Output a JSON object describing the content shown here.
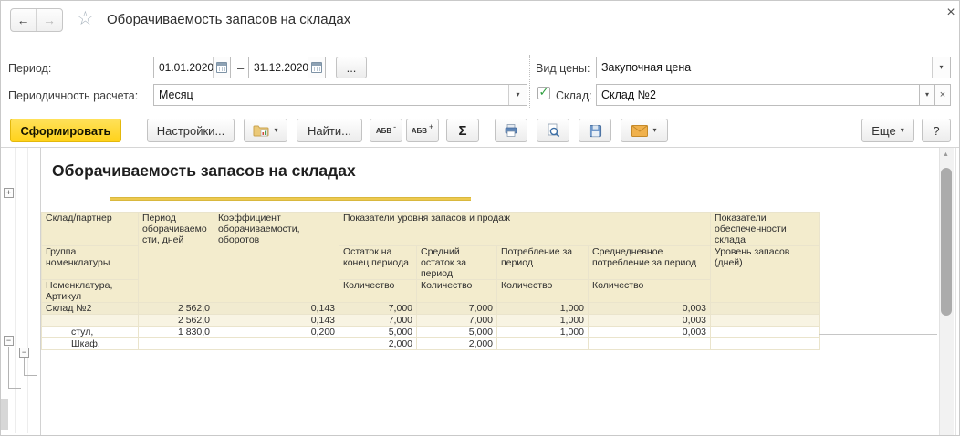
{
  "window": {
    "title": "Оборачиваемость запасов на складах"
  },
  "icons": {
    "back": "←",
    "forward": "→",
    "favorite_star": "☆",
    "close": "×",
    "dropdown": "▾",
    "checkmark": "✓",
    "expand_plus": "+",
    "collapse_minus": "−",
    "scroll_up": "▲"
  },
  "filters": {
    "period_label": "Период:",
    "period_from": "01.01.2020",
    "period_to": "31.12.2020",
    "period_dash": "–",
    "period_more_label": "...",
    "periodicity_label": "Периодичность расчета:",
    "periodicity_value": "Месяц",
    "price_type_label": "Вид цены:",
    "price_type_value": "Закупочная цена",
    "warehouse_label": "Склад:",
    "warehouse_value": "Склад №2"
  },
  "toolbar": {
    "generate_label": "Сформировать",
    "settings_label": "Настройки...",
    "find_label": "Найти...",
    "fontsize_label": "АБВ",
    "font_decrease_sign": "-",
    "font_increase_sign": "+",
    "sum_label": "Σ",
    "more_label": "Еще",
    "help_label": "?"
  },
  "report": {
    "title": "Оборачиваемость запасов на складах"
  },
  "table": {
    "header": {
      "warehouse_partner": "Склад/партнер",
      "nomenclature_group": "Группа номенклатуры",
      "nomenclature_article": "Номенклатура, Артикул",
      "turnover_period_days": "Период оборачиваемости, дней",
      "turnover_ratio": "Коэффициент оборачиваемости, оборотов",
      "stock_sales_group": "Показатели уровня запасов и продаж",
      "end_of_period_balance": "Остаток на конец периода",
      "average_balance": "Средний остаток за период",
      "consumption": "Потребление за период",
      "avg_daily_consumption": "Среднедневное потребление за период",
      "supply_group": "Показатели обеспеченности склада",
      "stock_level_days": "Уровень запасов (дней)",
      "quantity": "Количество"
    },
    "rows": [
      {
        "name": "Склад №2",
        "indent": 0,
        "style": "group1",
        "values": [
          "2 562,0",
          "0,143",
          "7,000",
          "7,000",
          "1,000",
          "0,003",
          ""
        ]
      },
      {
        "name": "",
        "indent": 1,
        "style": "group2",
        "values": [
          "2 562,0",
          "0,143",
          "7,000",
          "7,000",
          "1,000",
          "0,003",
          ""
        ]
      },
      {
        "name": "стул,",
        "indent": 2,
        "style": "detail",
        "values": [
          "1 830,0",
          "0,200",
          "5,000",
          "5,000",
          "1,000",
          "0,003",
          ""
        ]
      },
      {
        "name": "Шкаф,",
        "indent": 2,
        "style": "detail",
        "values": [
          "",
          "",
          "2,000",
          "2,000",
          "",
          "",
          ""
        ]
      }
    ]
  },
  "colors": {
    "accent_yellow": "#FFD21A",
    "accent_yellow_border": "#E3B80C",
    "header_beige": "#F3ECCD",
    "group_row1_bg": "#F1EBD0",
    "group_row2_bg": "#F8F4E3",
    "underline_gold": "#EDC94F",
    "check_green": "#2E9E3E",
    "table_border": "#CBC2A2"
  }
}
